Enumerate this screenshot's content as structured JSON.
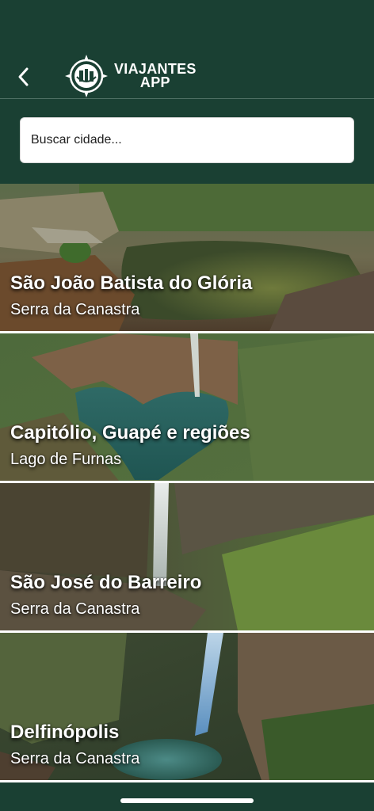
{
  "header": {
    "back_icon": "chevron-left-icon",
    "logo_icon": "compass-waterfall-icon",
    "logo_line1": "VIAJANTES",
    "logo_line2": "APP"
  },
  "search": {
    "placeholder": "Buscar cidade..."
  },
  "cities": [
    {
      "title": "São João Batista do Glória",
      "subtitle": "Serra da Canastra"
    },
    {
      "title": "Capitólio, Guapé e regiões",
      "subtitle": "Lago de Furnas"
    },
    {
      "title": "São José do Barreiro",
      "subtitle": "Serra da Canastra"
    },
    {
      "title": "Delfinópolis",
      "subtitle": "Serra da Canastra"
    }
  ],
  "colors": {
    "primary": "#1a4033",
    "search_bg": "#ffffff",
    "text_light": "#ffffff"
  }
}
